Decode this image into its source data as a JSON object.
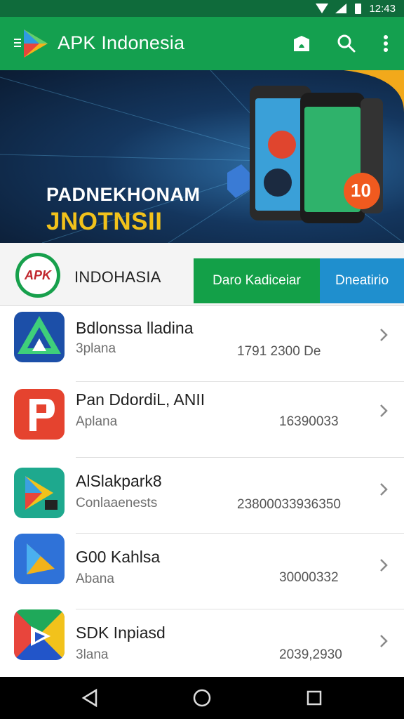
{
  "status_bar": {
    "time": "12:43"
  },
  "app_bar": {
    "title": "APK Indonesia",
    "icons": [
      "menu-icon",
      "play-logo-icon",
      "store-icon",
      "search-icon",
      "more-vert-icon"
    ]
  },
  "banner": {
    "line1": "PADNEKHONAM",
    "line2": "JNOTNSII",
    "badge": "10"
  },
  "tabs_row": {
    "brand_logo_text": "APK",
    "brand_name": "INDOHASIA",
    "tabs": [
      {
        "label": "Daro Kadiceiar"
      },
      {
        "label": "Dneatirio"
      }
    ]
  },
  "apps": [
    {
      "name": "Bdlonssa lladina",
      "sub": "3plana",
      "count": "1791 2300 De",
      "icon": "apk-a-icon"
    },
    {
      "name": "Pan DdordiL, ANII",
      "sub": "Aplana",
      "count": "16390033",
      "icon": "p-logo-icon"
    },
    {
      "name": "AlSlakpark8",
      "sub": "Conlaaenests",
      "count": "23800033936350",
      "icon": "play-store-icon"
    },
    {
      "name": "G00 Kahlsa",
      "sub": "Abana",
      "count": "30000332",
      "icon": "play-triangle-icon"
    },
    {
      "name": "SDK Inpiasd",
      "sub": "3lana",
      "count": "2039,2930",
      "icon": "multicolor-play-icon"
    }
  ],
  "colors": {
    "status_bar": "#0f6b3b",
    "app_bar": "#14a04f",
    "tab_primary": "#13a048",
    "tab_secondary": "#1f8fce",
    "banner_accent": "#f2c21b"
  }
}
